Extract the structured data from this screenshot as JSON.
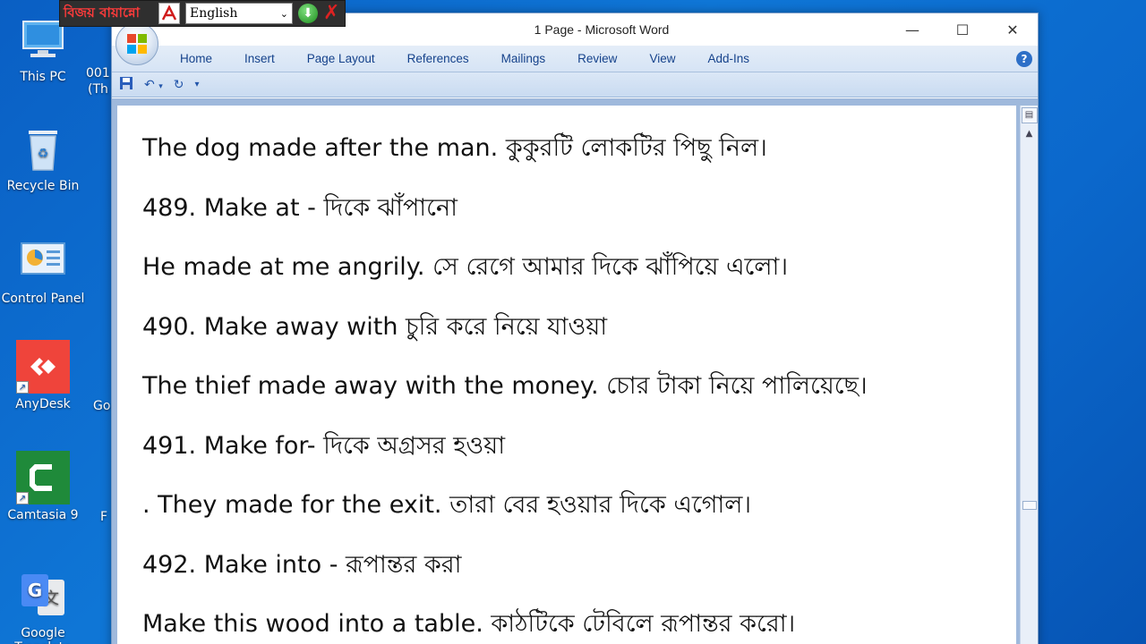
{
  "desktop": {
    "icons": [
      {
        "label": "This PC",
        "icon": "computer-icon"
      },
      {
        "label": "Recycle Bin",
        "icon": "recycle-bin-icon"
      },
      {
        "label": "Control Panel",
        "icon": "control-panel-icon"
      },
      {
        "label": "AnyDesk",
        "icon": "anydesk-icon"
      },
      {
        "label": "Camtasia 9",
        "icon": "camtasia-icon"
      },
      {
        "label": "Google Translate",
        "icon": "google-translate-icon"
      }
    ],
    "partial": [
      "001",
      "(Th",
      "Go",
      "F"
    ]
  },
  "langbar": {
    "logo": "বিজয় বায়ান্নো",
    "language": "English"
  },
  "word": {
    "title": "1 Page - Microsoft Word",
    "tabs": [
      "Home",
      "Insert",
      "Page Layout",
      "References",
      "Mailings",
      "Review",
      "View",
      "Add-Ins"
    ],
    "help": "?",
    "qat": [
      "save",
      "undo",
      "redo",
      "customize"
    ]
  },
  "document": {
    "lines": [
      "The dog made after the man. কুকুরটি লোকটির পিছু নিল।",
      "489. Make at - দিকে ঝাঁপানো",
      "He made at me angrily. সে রেগে আমার দিকে ঝাঁপিয়ে এলো।",
      "490. Make away with চুরি করে নিয়ে যাওয়া",
      "The thief made away with the money. চোর টাকা নিয়ে পালিয়েছে।",
      "491. Make for- দিকে অগ্রসর হওয়া",
      ". They made for the exit. তারা বের হওয়ার দিকে এগোল।",
      "492. Make into - রূপান্তর করা",
      "Make this wood into a table. কাঠটিকে টেবিলে রূপান্তর করো।"
    ]
  },
  "colors": {
    "desktop_bg": "#0b68cc",
    "ribbon_text": "#15428b",
    "ribbon_bg": "#d6e4f5",
    "doc_bg": "#9fb9dc"
  }
}
